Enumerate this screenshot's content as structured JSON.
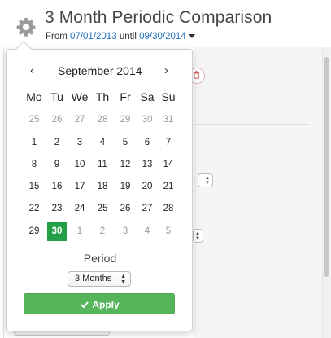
{
  "header": {
    "title": "3 Month Periodic Comparison",
    "from_label": "From",
    "from_date": "07/01/2013",
    "until_label": "until",
    "until_date": "09/30/2014"
  },
  "calendar": {
    "prev": "‹",
    "next": "›",
    "month_year": "September 2014",
    "weekdays": [
      "Mo",
      "Tu",
      "We",
      "Th",
      "Fr",
      "Sa",
      "Su"
    ],
    "weeks": [
      [
        "25",
        "26",
        "27",
        "28",
        "29",
        "30",
        "31"
      ],
      [
        "1",
        "2",
        "3",
        "4",
        "5",
        "6",
        "7"
      ],
      [
        "8",
        "9",
        "10",
        "11",
        "12",
        "13",
        "14"
      ],
      [
        "15",
        "16",
        "17",
        "18",
        "19",
        "20",
        "21"
      ],
      [
        "22",
        "23",
        "24",
        "25",
        "26",
        "27",
        "28"
      ],
      [
        "29",
        "30",
        "1",
        "2",
        "3",
        "4",
        "5"
      ]
    ],
    "selected_day": "30"
  },
  "period": {
    "label": "Period",
    "selected": "3 Months"
  },
  "apply_label": "Apply",
  "colors": {
    "accent_green": "#23a047",
    "button_green": "#56b45b",
    "link_blue": "#1f6fc0"
  }
}
